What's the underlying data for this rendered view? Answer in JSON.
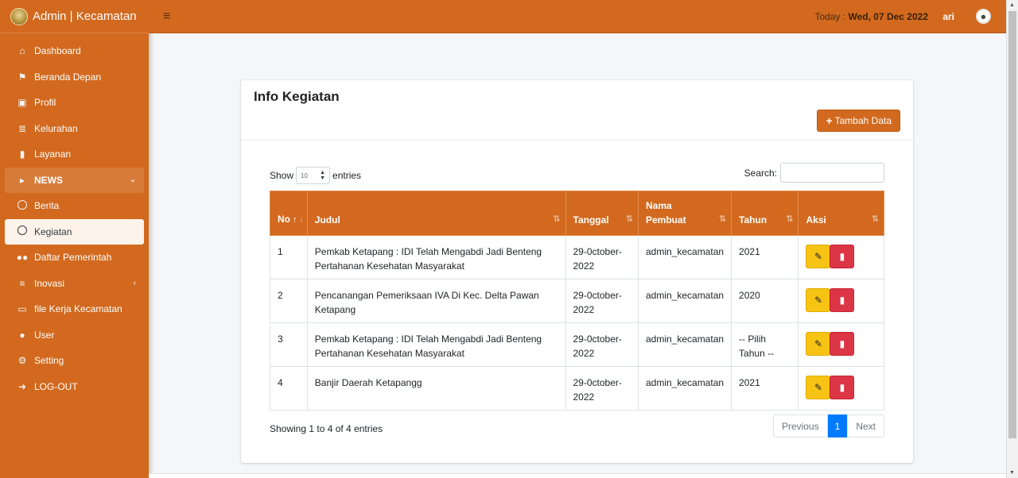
{
  "brand": {
    "title": "Admin | Kecamatan"
  },
  "topbar": {
    "today_label": "Today :",
    "today_value": "Wed, 07 Dec 2022",
    "user": "ari"
  },
  "sidebar": {
    "items": [
      {
        "label": "Dashboard",
        "icon": "home-icon"
      },
      {
        "label": "Beranda Depan",
        "icon": "tags-icon"
      },
      {
        "label": "Profil",
        "icon": "book-icon"
      },
      {
        "label": "Kelurahan",
        "icon": "institution-icon"
      },
      {
        "label": "Layanan",
        "icon": "file-icon"
      },
      {
        "label": "NEWS",
        "icon": "bullhorn-icon"
      },
      {
        "label": "Berita",
        "icon": "circle-icon"
      },
      {
        "label": "Kegiatan",
        "icon": "circle-icon"
      },
      {
        "label": "Daftar Pemerintah",
        "icon": "users-icon"
      },
      {
        "label": "Inovasi",
        "icon": "bars-icon"
      },
      {
        "label": "file Kerja Kecamatan",
        "icon": "folder-open-icon"
      },
      {
        "label": "User",
        "icon": "user-icon"
      },
      {
        "label": "Setting",
        "icon": "gear-icon"
      },
      {
        "label": "LOG-OUT",
        "icon": "sign-out-icon"
      }
    ]
  },
  "card": {
    "title": "Info Kegiatan",
    "add_label": "Tambah Data"
  },
  "controls": {
    "show_label": "Show",
    "entries_value": "10",
    "entries_label": "entries",
    "search_label": "Search:"
  },
  "table": {
    "headers": [
      "No",
      "Judul",
      "Tanggal",
      "Nama Pembuat",
      "Tahun",
      "Aksi"
    ],
    "rows": [
      {
        "no": "1",
        "judul": "Pemkab Ketapang : IDI Telah Mengabdi Jadi Benteng Pertahanan Kesehatan Masyarakat",
        "tanggal": "29-0ctober-2022",
        "pembuat": "admin_kecamatan",
        "tahun": "2021"
      },
      {
        "no": "2",
        "judul": "Pencanangan Pemeriksaan IVA Di Kec. Delta Pawan Ketapang",
        "tanggal": "29-0ctober-2022",
        "pembuat": "admin_kecamatan",
        "tahun": "2020"
      },
      {
        "no": "3",
        "judul": "Pemkab Ketapang : IDI Telah Mengabdi Jadi Benteng Pertahanan Kesehatan Masyarakat",
        "tanggal": "29-0ctober-2022",
        "pembuat": "admin_kecamatan",
        "tahun": "-- Pilih Tahun --"
      },
      {
        "no": "4",
        "judul": "Banjir Daerah Ketapangg",
        "tanggal": "29-0ctober-2022",
        "pembuat": "admin_kecamatan",
        "tahun": "2021"
      }
    ]
  },
  "footer": {
    "info": "Showing 1 to 4 of 4 entries",
    "prev": "Previous",
    "page": "1",
    "next": "Next"
  },
  "colors": {
    "accent": "#d2691e",
    "edit": "#f7c416",
    "delete": "#dc3545",
    "page_active": "#007bff"
  }
}
